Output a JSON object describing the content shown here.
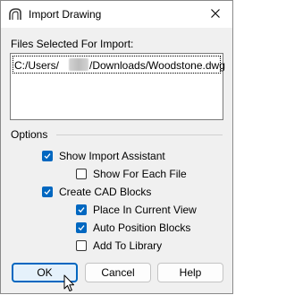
{
  "window": {
    "title": "Import Drawing",
    "app_icon": "arch-icon",
    "close_icon": "close-icon"
  },
  "files": {
    "label": "Files Selected For Import:",
    "entries": [
      {
        "prefix": "C:/Users/",
        "redacted": true,
        "suffix": "/Downloads/Woodstone.dwg"
      }
    ]
  },
  "options": {
    "label": "Options",
    "checkboxes": [
      {
        "label": "Show Import Assistant",
        "checked": true
      },
      {
        "label": "Show For Each File",
        "checked": false
      },
      {
        "label": "Create CAD Blocks",
        "checked": true
      },
      {
        "label": "Place In Current View",
        "checked": true
      },
      {
        "label": "Auto Position Blocks",
        "checked": true
      },
      {
        "label": "Add To Library",
        "checked": false
      }
    ]
  },
  "buttons": {
    "ok": "OK",
    "cancel": "Cancel",
    "help": "Help"
  },
  "colors": {
    "accent": "#0067c0",
    "dialog_bg": "#f0f0f0"
  }
}
